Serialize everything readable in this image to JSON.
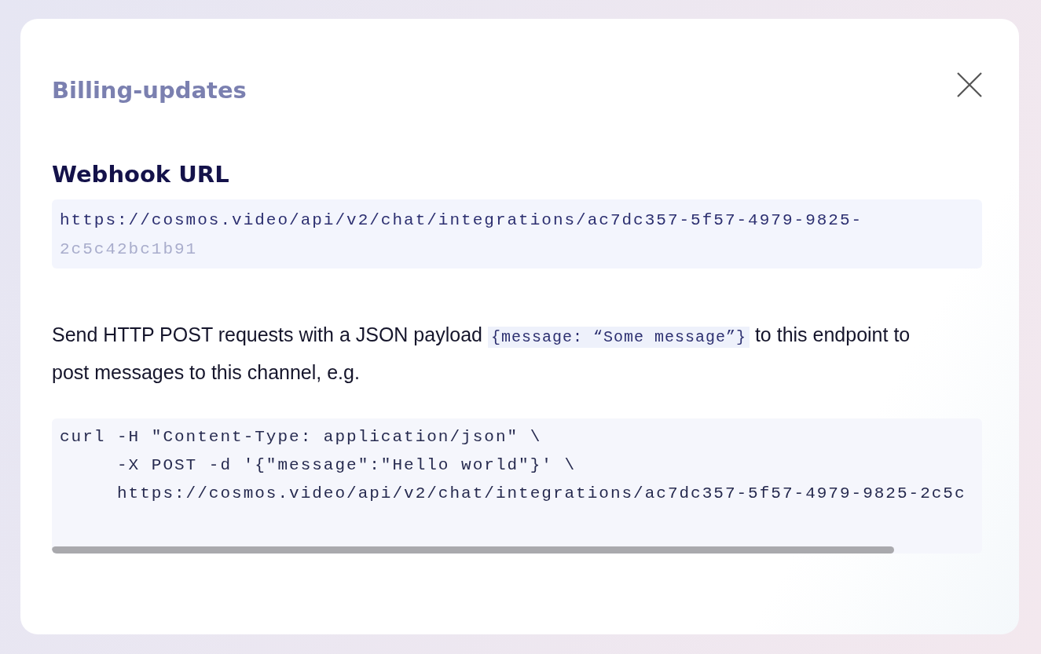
{
  "dialog": {
    "title": "Billing-updates",
    "webhook": {
      "heading": "Webhook URL",
      "url_lines": [
        "https://cosmos.video/api/v2/chat/integrations/ac7dc357-5f57-4979-9825-",
        "2c5c42bc1b91"
      ]
    },
    "description": {
      "before": "Send HTTP POST requests with a JSON payload",
      "code": "{message: “Some message”}",
      "after": "to this endpoint to post messages to this channel, e.g."
    },
    "example_lines": [
      "curl -H \"Content-Type: application/json\" \\",
      "     -X POST -d '{\"message\":\"Hello world\"}' \\",
      "     https://cosmos.video/api/v2/chat/integrations/ac7dc357-5f57-4979-9825-2c5c"
    ]
  }
}
